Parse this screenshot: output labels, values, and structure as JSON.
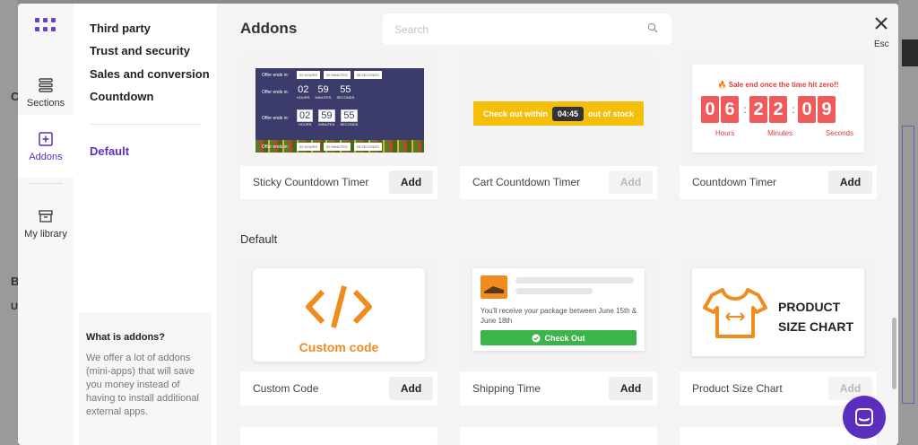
{
  "background": {
    "fragments": [
      "C",
      "B",
      "U"
    ]
  },
  "rail": {
    "items": [
      {
        "label": "Sections",
        "icon": "sections-icon"
      },
      {
        "label": "Addons",
        "icon": "addons-icon"
      },
      {
        "label": "My library",
        "icon": "library-icon"
      }
    ]
  },
  "categories": {
    "items": [
      "Third party",
      "Trust and security",
      "Sales and conversion",
      "Countdown"
    ],
    "default_label": "Default"
  },
  "info": {
    "title": "What is addons?",
    "text": "We offer a lot of addons (mini-apps) that will save you money instead of having to install additional external apps."
  },
  "main": {
    "title": "Addons",
    "search_placeholder": "Search",
    "esc_label": "Esc",
    "section_default": "Default",
    "add_label": "Add"
  },
  "cards": {
    "sticky": {
      "name": "Sticky Countdown Timer",
      "offer_label": "Offer ends in:",
      "chips": [
        "02 HOURS",
        "59 MINUTES",
        "55 SECONDS"
      ],
      "hours": "02",
      "minutes": "59",
      "seconds": "55",
      "unit_hours": "HOURS",
      "unit_minutes": "MINUTES",
      "unit_seconds": "SECONDS"
    },
    "cart": {
      "name": "Cart Countdown Timer",
      "before": "Check out within",
      "time": "04:45",
      "after": "out of stock"
    },
    "countdown": {
      "name": "Countdown Timer",
      "headline": "Sale end once the time hit zero!!",
      "digits": [
        "0",
        "6",
        "2",
        "2",
        "0",
        "9"
      ],
      "units": [
        "Hours",
        "Minutes",
        "Seconds"
      ]
    },
    "custom": {
      "name": "Custom Code",
      "label": "Custom code"
    },
    "shipping": {
      "name": "Shipping Time",
      "text": "You'll receive your package between June 15th & June 18th",
      "button": "Check Out"
    },
    "sizechart": {
      "name": "Product Size Chart",
      "line1": "PRODUCT",
      "line2": "SIZE CHART"
    }
  },
  "colors": {
    "accent": "#5a2fc0",
    "orange": "#f08c1e",
    "cart_yellow": "#f5be0b",
    "countdown_red": "#f05a5a",
    "green": "#3db44a"
  }
}
